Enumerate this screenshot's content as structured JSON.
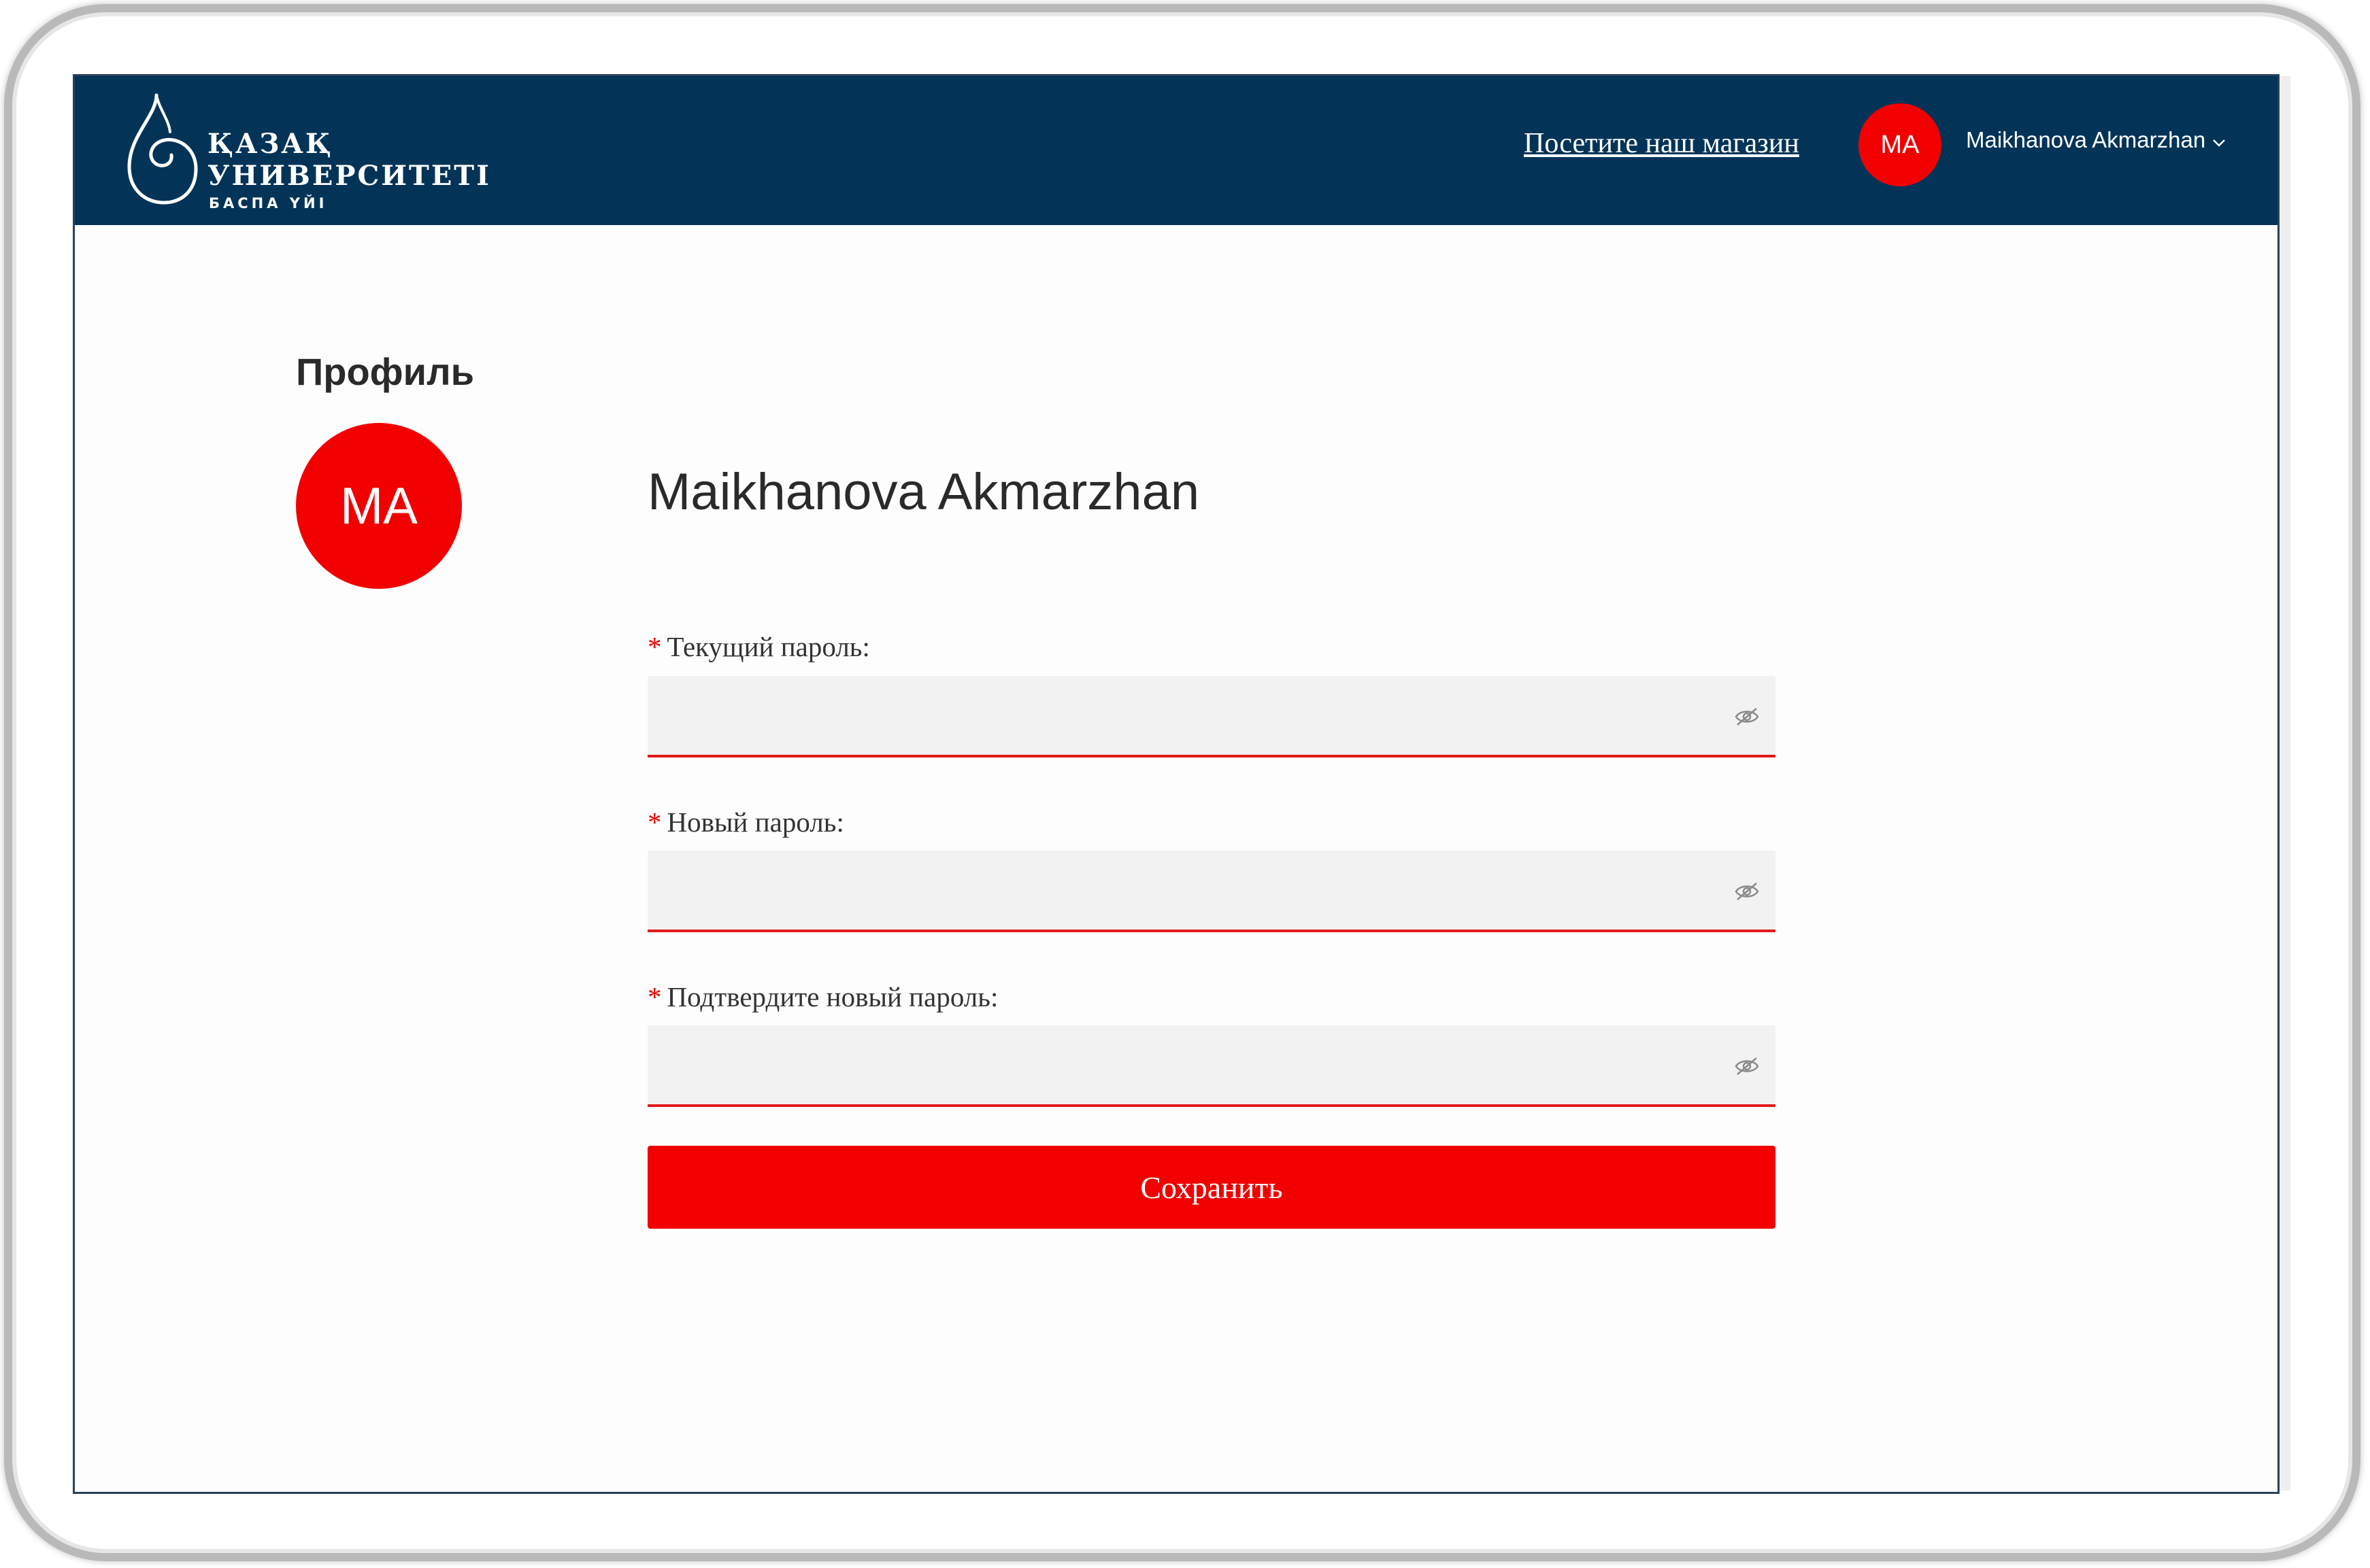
{
  "header": {
    "logo": {
      "line1": "ҚАЗАҚ",
      "line2": "УНИВЕРСИТЕТІ",
      "line3": "БАСПА ҮЙІ"
    },
    "shop_link": "Посетите наш магазин",
    "avatar_initials": "MA",
    "user_name": "Maikhanova Akmarzhan"
  },
  "profile": {
    "title": "Профиль",
    "avatar_initials": "MA",
    "name": "Maikhanova Akmarzhan"
  },
  "form": {
    "required_mark": "*",
    "fields": [
      {
        "label": "Текущий пароль:",
        "value": ""
      },
      {
        "label": "Новый пароль:",
        "value": ""
      },
      {
        "label": "Подтвердите новый пароль:",
        "value": ""
      }
    ],
    "save_label": "Сохранить"
  },
  "colors": {
    "header_bg": "#033458",
    "accent": "#f20000"
  },
  "icons": {
    "password_toggle": "eye-slash-icon",
    "user_menu": "chevron-down-icon",
    "logo": "drop-swirl-icon"
  }
}
